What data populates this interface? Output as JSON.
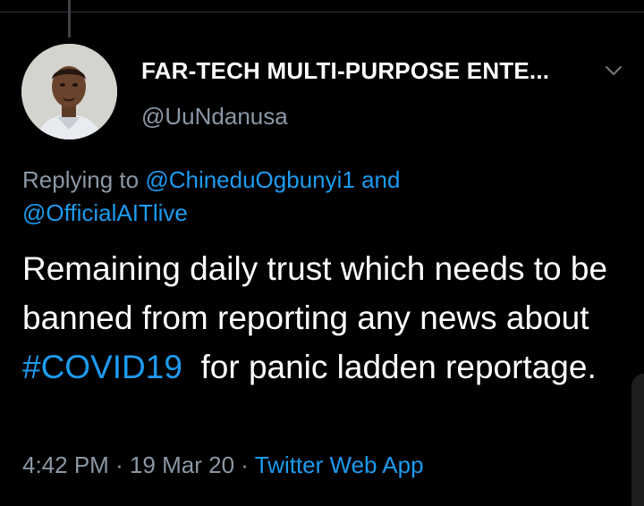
{
  "tweet": {
    "author": {
      "display_name": "FAR-TECH MULTI-PURPOSE ENTE...",
      "handle": "@UuNdanusa",
      "avatar": "profile-photo"
    },
    "menu_icon": "chevron-down-icon",
    "reply_context": {
      "prefix": "Replying to",
      "mentions": [
        "@ChineduOgbunyi1",
        "@OfficialAITlive"
      ],
      "conjunction": "and"
    },
    "body": {
      "text_before": "Remaining daily trust which needs to be banned from reporting any news about ",
      "hashtag": "#COVID19",
      "text_after": "  for panic ladden reportage."
    },
    "meta": {
      "time": "4:42 PM",
      "separator": "·",
      "date": "19 Mar 20",
      "source": "Twitter Web App"
    }
  },
  "colors": {
    "background": "#000000",
    "text": "#ffffff",
    "secondary_text": "#8b98a5",
    "link": "#1d9bf0"
  }
}
